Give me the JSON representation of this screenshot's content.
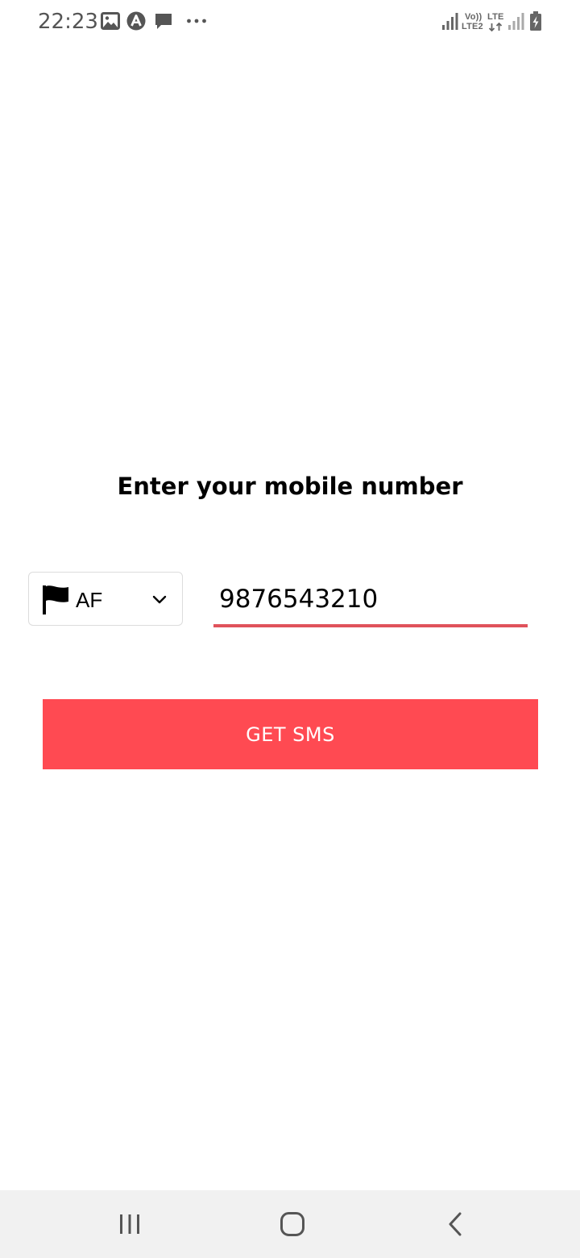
{
  "status_bar": {
    "time": "22:23",
    "notification_icons": [
      "image-icon",
      "app-a-icon",
      "message-icon",
      "more-dots-icon"
    ],
    "network_label_volte": "Vo))",
    "network_label_lte2": "LTE2",
    "network_label_lte": "LTE",
    "system_icons": [
      "signal-icon",
      "data-arrows-icon",
      "signal-icon",
      "battery-charging-icon"
    ]
  },
  "main": {
    "title": "Enter your mobile number",
    "country": {
      "code": "AF",
      "flag_icon": "flag-icon",
      "dropdown_icon": "chevron-down-icon"
    },
    "phone": {
      "value": "9876543210"
    },
    "get_sms_label": "GET SMS"
  },
  "nav_bar": {
    "buttons": [
      "recents-icon",
      "home-icon",
      "back-icon"
    ]
  },
  "colors": {
    "accent": "#ff4a52",
    "underline": "#e0525b",
    "nav_background": "#f1f1f1",
    "status_text": "#555555"
  }
}
